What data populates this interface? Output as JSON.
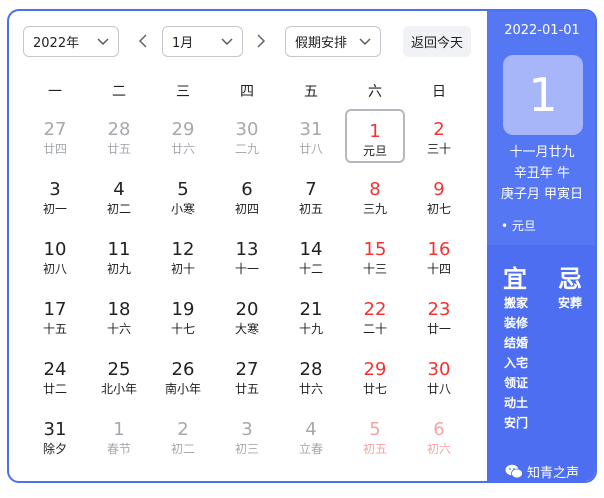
{
  "toolbar": {
    "year": "2022年",
    "month": "1月",
    "holiday": "假期安排",
    "today_button": "返回今天"
  },
  "weekdays": [
    "一",
    "二",
    "三",
    "四",
    "五",
    "六",
    "日"
  ],
  "days": [
    {
      "n": "27",
      "l": "廿四",
      "t": "other"
    },
    {
      "n": "28",
      "l": "廿五",
      "t": "other"
    },
    {
      "n": "29",
      "l": "廿六",
      "t": "other"
    },
    {
      "n": "30",
      "l": "二九",
      "t": "other"
    },
    {
      "n": "31",
      "l": "廿八",
      "t": "other"
    },
    {
      "n": "1",
      "l": "元旦",
      "t": "weekend",
      "sel": true
    },
    {
      "n": "2",
      "l": "三十",
      "t": "weekend"
    },
    {
      "n": "3",
      "l": "初一",
      "t": "normal"
    },
    {
      "n": "4",
      "l": "初二",
      "t": "normal"
    },
    {
      "n": "5",
      "l": "小寒",
      "t": "normal"
    },
    {
      "n": "6",
      "l": "初四",
      "t": "normal"
    },
    {
      "n": "7",
      "l": "初五",
      "t": "normal"
    },
    {
      "n": "8",
      "l": "三九",
      "t": "weekend"
    },
    {
      "n": "9",
      "l": "初七",
      "t": "weekend"
    },
    {
      "n": "10",
      "l": "初八",
      "t": "normal"
    },
    {
      "n": "11",
      "l": "初九",
      "t": "normal"
    },
    {
      "n": "12",
      "l": "初十",
      "t": "normal"
    },
    {
      "n": "13",
      "l": "十一",
      "t": "normal"
    },
    {
      "n": "14",
      "l": "十二",
      "t": "normal"
    },
    {
      "n": "15",
      "l": "十三",
      "t": "weekend"
    },
    {
      "n": "16",
      "l": "十四",
      "t": "weekend"
    },
    {
      "n": "17",
      "l": "十五",
      "t": "normal"
    },
    {
      "n": "18",
      "l": "十六",
      "t": "normal"
    },
    {
      "n": "19",
      "l": "十七",
      "t": "normal"
    },
    {
      "n": "20",
      "l": "大寒",
      "t": "normal"
    },
    {
      "n": "21",
      "l": "十九",
      "t": "normal"
    },
    {
      "n": "22",
      "l": "二十",
      "t": "weekend"
    },
    {
      "n": "23",
      "l": "廿一",
      "t": "weekend"
    },
    {
      "n": "24",
      "l": "廿二",
      "t": "normal"
    },
    {
      "n": "25",
      "l": "北小年",
      "t": "normal"
    },
    {
      "n": "26",
      "l": "南小年",
      "t": "normal"
    },
    {
      "n": "27",
      "l": "廿五",
      "t": "normal"
    },
    {
      "n": "28",
      "l": "廿六",
      "t": "normal"
    },
    {
      "n": "29",
      "l": "廿七",
      "t": "weekend"
    },
    {
      "n": "30",
      "l": "廿八",
      "t": "weekend"
    },
    {
      "n": "31",
      "l": "除夕",
      "t": "normal"
    },
    {
      "n": "1",
      "l": "春节",
      "t": "other"
    },
    {
      "n": "2",
      "l": "初二",
      "t": "other"
    },
    {
      "n": "3",
      "l": "初三",
      "t": "other"
    },
    {
      "n": "4",
      "l": "立春",
      "t": "other"
    },
    {
      "n": "5",
      "l": "初五",
      "t": "other-weekend"
    },
    {
      "n": "6",
      "l": "初六",
      "t": "other-weekend"
    }
  ],
  "detail": {
    "date": "2022-01-01",
    "day": "1",
    "lunar": "十一月廿九",
    "year_gz": "辛丑年 牛",
    "month_day_gz": "庚子月 甲寅日",
    "festival": "• 元旦",
    "yi": "宜",
    "ji": "忌",
    "yi_items": [
      "搬家",
      "装修",
      "结婚",
      "入宅",
      "领证",
      "动土",
      "安门"
    ],
    "ji_items": [
      "安葬"
    ],
    "watermark": "知青之声"
  },
  "colors": {
    "accent": "#4e6ef2",
    "weekend": "#f73131"
  }
}
